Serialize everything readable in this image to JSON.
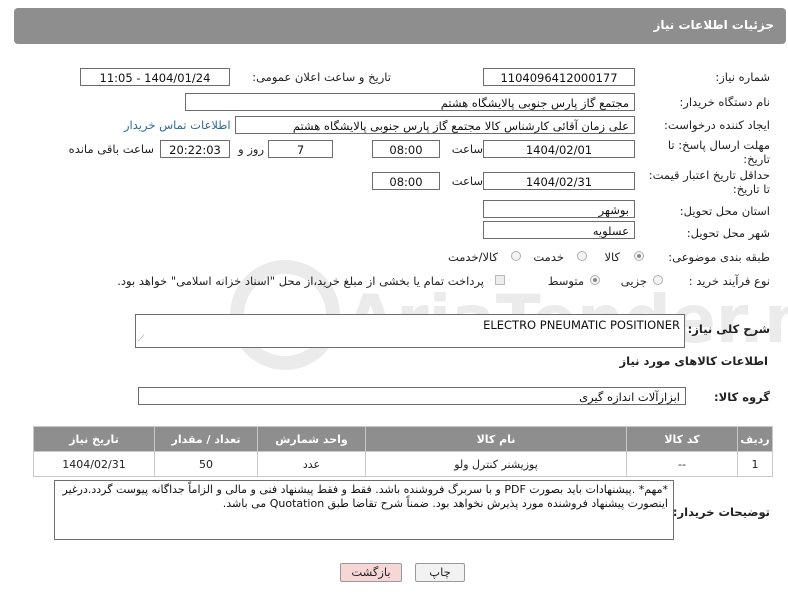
{
  "header": {
    "title": "جزئیات اطلاعات نیاز"
  },
  "form": {
    "need_number_label": "شماره نیاز:",
    "need_number": "1104096412000177",
    "announce_label": "تاریخ و ساعت اعلان عمومی:",
    "announce_value": "1404/01/24 - 11:05",
    "buyer_org_label": "نام دستگاه خریدار:",
    "buyer_org": "مجتمع گاز پارس جنوبی  پالایشگاه هشتم",
    "creator_label": "ایجاد کننده درخواست:",
    "creator": "علی زمان آقائی کارشناس کالا مجتمع گاز پارس جنوبی  پالایشگاه هشتم",
    "contact_link": "اطلاعات تماس خریدار",
    "deadline_label_1": "مهلت ارسال پاسخ: تا",
    "deadline_label_2": "تاریخ:",
    "deadline_date": "1404/02/01",
    "time_label": "ساعت",
    "deadline_time": "08:00",
    "days_value": "7",
    "days_label": "روز و",
    "remaining_time": "20:22:03",
    "remaining_label": "ساعت باقی مانده",
    "validity_label_1": "حداقل تاریخ اعتبار قیمت:",
    "validity_label_2": "تا تاریخ:",
    "validity_date": "1404/02/31",
    "validity_time": "08:00",
    "province_label": "استان محل تحویل:",
    "province": "بوشهر",
    "city_label": "شهر محل تحویل:",
    "city": "عسلویه",
    "category_label": "طبقه بندی موضوعی:",
    "category_options": [
      "کالا",
      "خدمت",
      "کالا/خدمت"
    ],
    "process_label": "نوع فرآیند خرید :",
    "process_options": [
      "جزیی",
      "متوسط"
    ],
    "payment_note": "پرداخت تمام یا بخشی از مبلغ خرید،از محل \"اسناد خزانه اسلامی\" خواهد بود."
  },
  "description": {
    "label": "شرح کلی نیاز:",
    "value": "ELECTRO PNEUMATIC POSITIONER"
  },
  "goods_section": {
    "title": "اطلاعات کالاهای مورد نیاز",
    "group_label": "گروه کالا:",
    "group_value": "ابزارآلات اندازه گیری"
  },
  "table": {
    "headers": [
      "ردیف",
      "کد کالا",
      "نام کالا",
      "واحد شمارش",
      "تعداد / مقدار",
      "تاریخ نیاز"
    ],
    "rows": [
      [
        "1",
        "--",
        "پوزیشنر کنترل ولو",
        "عدد",
        "50",
        "1404/02/31"
      ]
    ]
  },
  "buyer_notes": {
    "label": "توضیحات خریدار:",
    "text": "*مهم* .پیشنهادات باید بصورت PDF و با سربرگ فروشنده باشد. فقط و فقط پیشنهاد فنی و مالی و الزاماً جداگانه پیوست گردد.درغیر اینصورت پیشنهاد فروشنده مورد پذیرش نخواهد بود. ضمناً شرح تقاضا طبق Quotation می باشد."
  },
  "buttons": {
    "print": "چاپ",
    "back": "بازگشت"
  },
  "watermark": "AriaTender.neT",
  "colors": {
    "header": "#8e8e8e",
    "link": "#2d6aa3",
    "back_button": "#f7d6d6"
  }
}
